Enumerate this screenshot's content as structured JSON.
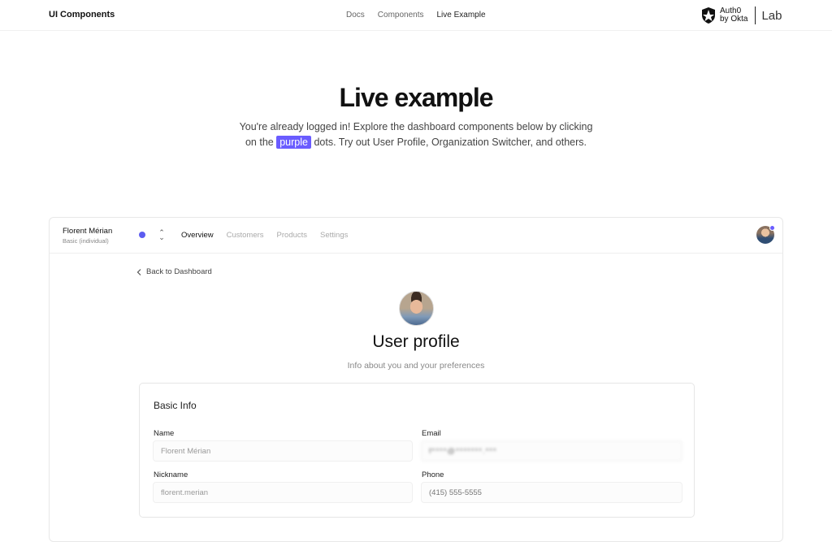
{
  "topnav": {
    "brand": "UI Components",
    "links": [
      {
        "label": "Docs"
      },
      {
        "label": "Components"
      },
      {
        "label": "Live Example"
      }
    ],
    "logo_line1": "Auth0",
    "logo_line2": "by Okta",
    "logo_lab": "Lab"
  },
  "hero": {
    "title": "Live example",
    "desc_before": "You're already logged in! Explore the dashboard components below by clicking on the",
    "desc_highlight": "purple",
    "desc_after": "dots. Try out User Profile, Organization Switcher, and others.",
    "highlight_color": "#6a5cff"
  },
  "dashboard": {
    "org_name": "Florent Mérian",
    "org_plan": "Basic (individual)",
    "tabs": [
      {
        "label": "Overview"
      },
      {
        "label": "Customers"
      },
      {
        "label": "Products"
      },
      {
        "label": "Settings"
      }
    ],
    "back_link": "Back to Dashboard",
    "profile_title": "User profile",
    "profile_subtitle": "Info about you and your preferences",
    "card": {
      "title": "Basic Info",
      "name_label": "Name",
      "name_value": "Florent Mérian",
      "email_label": "Email",
      "email_value": "f****@*******.***",
      "nickname_label": "Nickname",
      "nickname_value": "florent.merian",
      "phone_label": "Phone",
      "phone_placeholder": "(415) 555-5555"
    },
    "accent_color": "#5c5cf0"
  }
}
